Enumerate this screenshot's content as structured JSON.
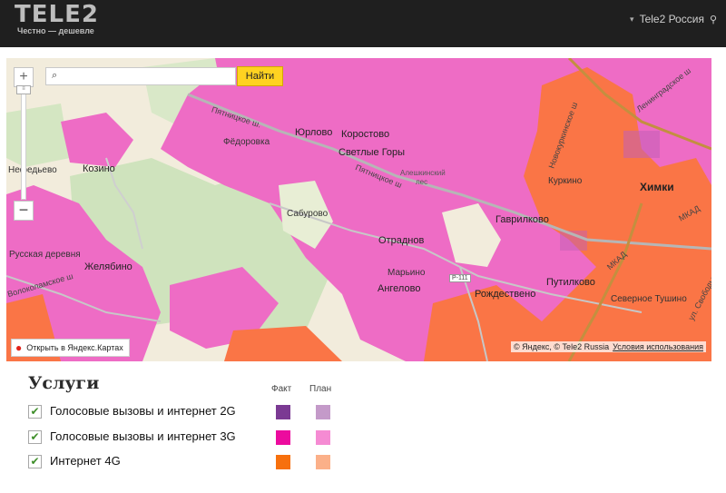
{
  "header": {
    "logo_text": "TELE2",
    "logo_tagline": "Честно — дешевле",
    "region_label": "Tele2 Россия",
    "region_chevron_icon": "chevron-down-icon",
    "location_icon": "location-pin-icon"
  },
  "map": {
    "search": {
      "placeholder": "",
      "value": "",
      "button_label": "Найти",
      "search_icon": "magnifier-icon"
    },
    "zoom": {
      "plus_label": "+",
      "minus_label": "−"
    },
    "open_in_yandex": "Открыть в Яндекс.Картах",
    "copyright_text": "© Яндекс, © Tele2 Russia",
    "terms_link": "Условия использования",
    "place_labels": [
      "Нефедьево",
      "Козино",
      "Фёдоровка",
      "Юрлово",
      "Коростово",
      "Светлые Горы",
      "Алешкинский",
      "лес",
      "Сабурово",
      "Гаврилково",
      "Куркино",
      "Химки",
      "Русская деревня",
      "Желябино",
      "Отраднов",
      "Марьино",
      "Ангелово",
      "Рождествено",
      "Путилково",
      "Северное Тушино"
    ],
    "road_labels": [
      "Пятницкое ш.",
      "Пятницкое ш",
      "Новокуркинское ш",
      "Ленинградское ш",
      "МКАД",
      "МКАД",
      "Волоколамское ш",
      "ул. Свободы",
      "Р-111"
    ],
    "coverage_colors": {
      "2g_fact": "#7a3a92",
      "3g_fact": "#e815a0",
      "4g_fact": "#ff6a1a",
      "3g_fill": "#ee6cc5",
      "4g_fill": "#fa7546",
      "background": "#f0ead8"
    }
  },
  "legend": {
    "title": "Услуги",
    "col_fact": "Факт",
    "col_plan": "План",
    "rows": [
      {
        "label": "Голосовые вызовы и интернет 2G",
        "checked": true,
        "fact_color": "#7b3a93",
        "plan_color": "#c49ac9"
      },
      {
        "label": "Голосовые вызовы и интернет 3G",
        "checked": true,
        "fact_color": "#ec0b9e",
        "plan_color": "#f58bd3"
      },
      {
        "label": "Интернет 4G",
        "checked": true,
        "fact_color": "#f7700d",
        "plan_color": "#fbb089"
      }
    ]
  }
}
